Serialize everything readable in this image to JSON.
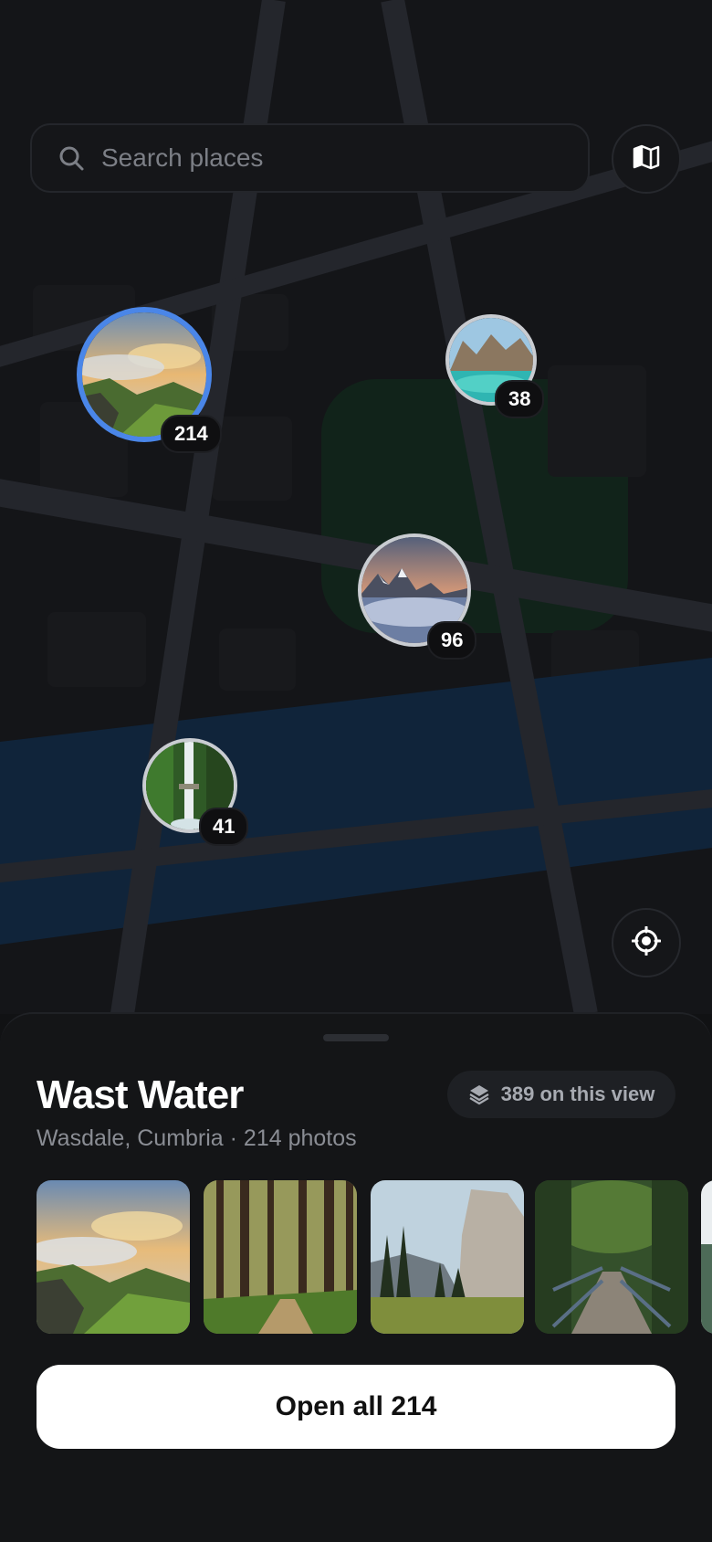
{
  "search": {
    "placeholder": "Search places"
  },
  "clusters": [
    {
      "name": "cluster-pin-214",
      "count": "214",
      "image": "misty green cliffs at sunset",
      "selected": true
    },
    {
      "name": "cluster-pin-38",
      "count": "38",
      "image": "turquoise mountain lake"
    },
    {
      "name": "cluster-pin-96",
      "count": "96",
      "image": "snowy peaks above clouds at dusk"
    },
    {
      "name": "cluster-pin-41",
      "count": "41",
      "image": "waterfall in mossy forest"
    }
  ],
  "sheet": {
    "title": "Wast Water",
    "subtitle": "Wasdale, Cumbria · 214 photos",
    "badge": "389 on this view",
    "open_button": "Open all 214",
    "photos": [
      "misty green cliffs",
      "sunlit forest path",
      "granite cliff valley",
      "forest footbridge",
      "partial photo"
    ]
  },
  "colors": {
    "accent": "#4a86e8",
    "background": "#111214",
    "water": "#10243a",
    "park": "#11231a",
    "road": "#24262c"
  },
  "icons": {
    "search": "search-icon",
    "map_style": "map-icon",
    "locate": "locate-icon",
    "layers": "layers-icon"
  }
}
